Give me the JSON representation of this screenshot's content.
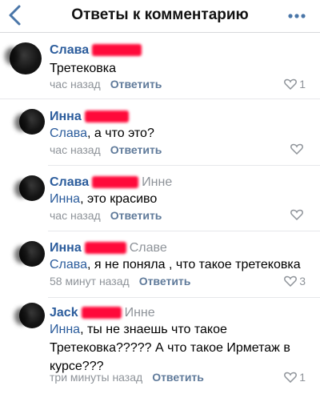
{
  "header": {
    "title": "Ответы к комментарию",
    "back_icon": "chevron-left-icon",
    "more_icon": "more-horizontal-icon",
    "accent": "#2b5c9c"
  },
  "comments": [
    {
      "author": "Слава",
      "reply_to": "",
      "mention": "",
      "text": "Третековка",
      "time": "час назад",
      "reply_label": "Ответить",
      "likes": "1"
    },
    {
      "author": "Инна",
      "reply_to": "",
      "mention": "Слава",
      "text": ", а что это?",
      "time": "час назад",
      "reply_label": "Ответить",
      "likes": ""
    },
    {
      "author": "Слава",
      "reply_to": "Инне",
      "mention": "Инна",
      "text": ", это красиво",
      "time": "час назад",
      "reply_label": "Ответить",
      "likes": ""
    },
    {
      "author": "Инна",
      "reply_to": "Славе",
      "mention": "Слава",
      "text": ", я не поняла , что такое третековка",
      "time": "58 минут назад",
      "reply_label": "Ответить",
      "likes": "3"
    },
    {
      "author": "Jack",
      "reply_to": "Инне",
      "mention": "Инна",
      "text": ", ты не знаешь что такое Третековка????? А что такое Ирметаж в курсе???",
      "time": "три минуты назад",
      "reply_label": "Ответить",
      "likes": "1"
    }
  ]
}
